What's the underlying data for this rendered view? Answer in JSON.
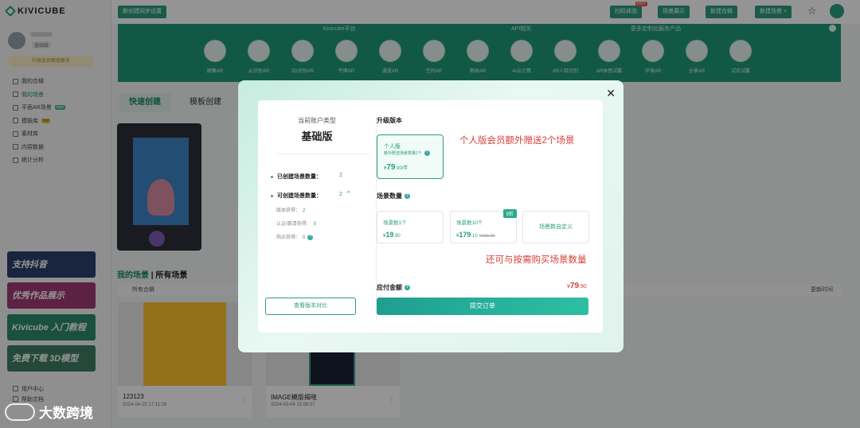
{
  "app": {
    "logo_text": "KIVICUBE"
  },
  "sidebar": {
    "upgrade_text": "升级会员解锁更多",
    "user_tag": "基础版",
    "nav": [
      {
        "label": "我的合辑",
        "icon": "folder-icon"
      },
      {
        "label": "我的场景",
        "icon": "scene-icon"
      },
      {
        "label": "平面AR场景",
        "icon": "cube-icon",
        "badge": "new"
      },
      {
        "label": "模板库",
        "icon": "template-icon",
        "badge": "hot"
      },
      {
        "label": "素材库",
        "icon": "material-icon"
      },
      {
        "label": "内容数据",
        "icon": "data-icon"
      },
      {
        "label": "统计分析",
        "icon": "chart-icon"
      }
    ],
    "promos": [
      "支持抖音",
      "优秀作品展示",
      "Kivicube 入门教程",
      "免费下载 3D模型"
    ],
    "bottom_nav": [
      "用户中心",
      "帮助文档"
    ]
  },
  "topbar": {
    "left_btn": "新创建同步设置",
    "buttons": [
      "扫码体验",
      "场景展示",
      "新建合辑",
      "新建场景 +"
    ],
    "hot_badge": "HOT"
  },
  "banner": {
    "labels": [
      "Kivicube平台",
      "API相关",
      "更多定制化服务产品"
    ],
    "items": [
      "图像AR",
      "云识别AR",
      "3D识别AR",
      "平面AR",
      "通道AR",
      "空间AR",
      "物体AR",
      "AI云计算",
      "AR人脸识别",
      "AR体感试戴",
      "环境AR",
      "全景AR",
      "试衣试戴"
    ]
  },
  "main": {
    "tabs": [
      "快速创建",
      "模板创建"
    ],
    "section_title_a": "我的场景",
    "section_title_b": "所有场景",
    "filter_label": "所有合辑",
    "sort_label": "更新时间",
    "cards": [
      {
        "name": "123123",
        "date": "2024-04-25 17:11:29"
      },
      {
        "name": "IMAGE模版揭晓",
        "date": "2024-03-04 15:08:37"
      }
    ]
  },
  "modal": {
    "account_type_label": "当前账户类型",
    "account_type": "基础版",
    "created_label": "已创建场景数量：",
    "created_value": "2",
    "available_label": "可创建场景数量：",
    "available_value": "2",
    "sub_rows": [
      {
        "label": "版本获得：",
        "value": "2"
      },
      {
        "label": "认证/邀请获得：",
        "value": "0"
      },
      {
        "label": "购买获得：",
        "value": "0"
      }
    ],
    "compare_btn": "查看版本对比",
    "upgrade_heading": "升级版本",
    "plan": {
      "name": "个人版",
      "desc": "额外赠送场景数量2个",
      "currency": "¥",
      "price": "79",
      "unit": ".90/年"
    },
    "annotation_1": "个人版会员额外赠送2个场景",
    "scene_heading": "场景数量",
    "packages": [
      {
        "label": "场景数1个",
        "currency": "¥",
        "price": "19",
        "cents": ".90"
      },
      {
        "label": "场景数10个",
        "currency": "¥",
        "price": "179",
        "cents": ".10",
        "old": "¥199.00",
        "discount": "9折"
      },
      {
        "label": "场景数自定义"
      }
    ],
    "annotation_2": "还可与按需购买场景数量",
    "pay_label": "应付金额",
    "pay_currency": "¥",
    "pay_amount": "79",
    "pay_cents": ".90",
    "submit_btn": "提交订单"
  },
  "watermark": {
    "text": "大数跨境"
  }
}
